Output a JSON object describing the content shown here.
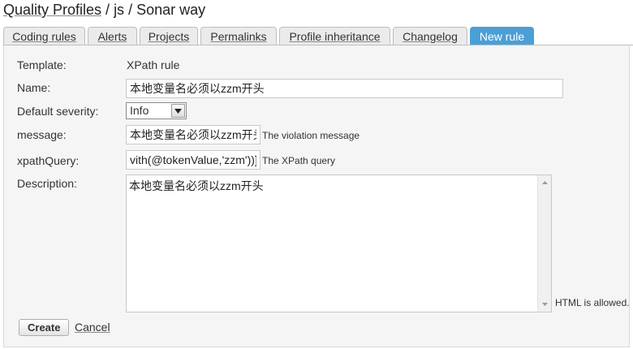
{
  "breadcrumb": {
    "part1": "Quality Profiles",
    "separator": " / ",
    "part2": "js",
    "part3": "Sonar way"
  },
  "tabs": [
    {
      "label": "Coding rules"
    },
    {
      "label": "Alerts"
    },
    {
      "label": "Projects"
    },
    {
      "label": "Permalinks"
    },
    {
      "label": "Profile inheritance"
    },
    {
      "label": "Changelog"
    },
    {
      "label": "New rule",
      "active": true
    }
  ],
  "form": {
    "template_label": "Template:",
    "template_value": "XPath rule",
    "name_label": "Name:",
    "name_value": "本地变量名必须以zzm开头",
    "severity_label": "Default severity:",
    "severity_value": "Info",
    "message_label": "message:",
    "message_value": "本地变量名必须以zzm开头",
    "message_hint": "The violation message",
    "xpath_label": "xpathQuery:",
    "xpath_value": "vith(@tokenValue,'zzm'))]",
    "xpath_hint": "The XPath query",
    "description_label": "Description:",
    "description_value": "本地变量名必须以zzm开头",
    "html_hint": "HTML is allowed.",
    "create_button": "Create",
    "cancel_link": "Cancel"
  },
  "colors": {
    "active_tab": "#4b9fd5",
    "panel_bg": "#f5f5f5"
  }
}
